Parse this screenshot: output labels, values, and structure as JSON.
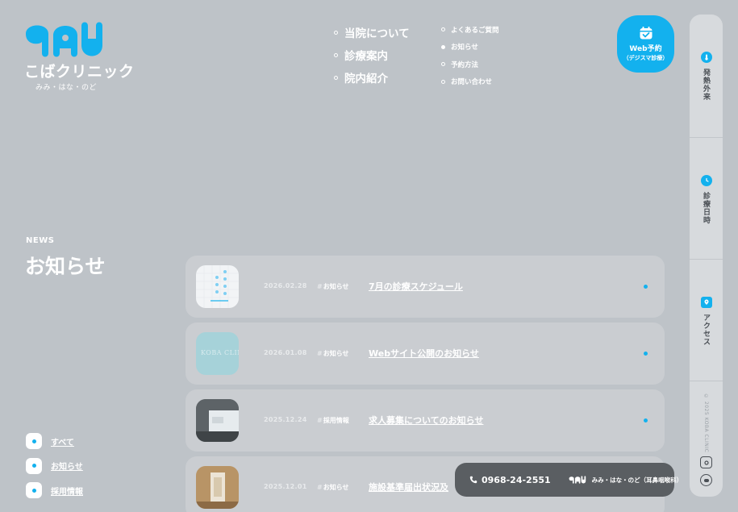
{
  "header": {
    "logo_name": "こばクリニック",
    "logo_sub": "みみ・はな・のど"
  },
  "main_nav": [
    {
      "label": "当院について"
    },
    {
      "label": "診療案内"
    },
    {
      "label": "院内紹介"
    }
  ],
  "sub_nav": [
    {
      "label": "よくあるご質問",
      "active": false
    },
    {
      "label": "お知らせ",
      "active": true
    },
    {
      "label": "予約方法",
      "active": false
    },
    {
      "label": "お問い合わせ",
      "active": false
    }
  ],
  "web_booking": {
    "line1": "Web予約",
    "line2": "（デジスマ診療）",
    "icon": "calendar-check-icon"
  },
  "side_rail": {
    "items": [
      {
        "label": "発熱外来",
        "icon": "fever-icon"
      },
      {
        "label": "診療日時",
        "icon": "clock-icon"
      },
      {
        "label": "アクセス",
        "icon": "map-pin-icon"
      }
    ],
    "copyright": "© 2025 KOBA CLINIC",
    "social": [
      {
        "icon": "instagram-icon"
      },
      {
        "icon": "line-icon"
      }
    ]
  },
  "news": {
    "label": "NEWS",
    "title": "お知らせ",
    "filters": [
      {
        "label": "すべて"
      },
      {
        "label": "お知らせ"
      },
      {
        "label": "採用情報"
      }
    ],
    "items": [
      {
        "date": "2026.02.28",
        "tag": "お知らせ",
        "title": "7月の診療スケジュール"
      },
      {
        "date": "2026.01.08",
        "tag": "お知らせ",
        "title": "Webサイト公開のお知らせ",
        "thumb_text": "KOBA CLINIC"
      },
      {
        "date": "2025.12.24",
        "tag": "採用情報",
        "title": "求人募集についてのお知らせ"
      },
      {
        "date": "2025.12.01",
        "tag": "お知らせ",
        "title": "施設基準届出状況及"
      }
    ]
  },
  "bottom_bar": {
    "phone": "0968-24-2551",
    "brand": "みみ・はな・のど（耳鼻咽喉科）",
    "phone_icon": "phone-icon"
  },
  "colors": {
    "accent": "#13b1ee",
    "background": "#bec3c8",
    "card": "#cacdd1",
    "bar": "#5a5e62"
  }
}
